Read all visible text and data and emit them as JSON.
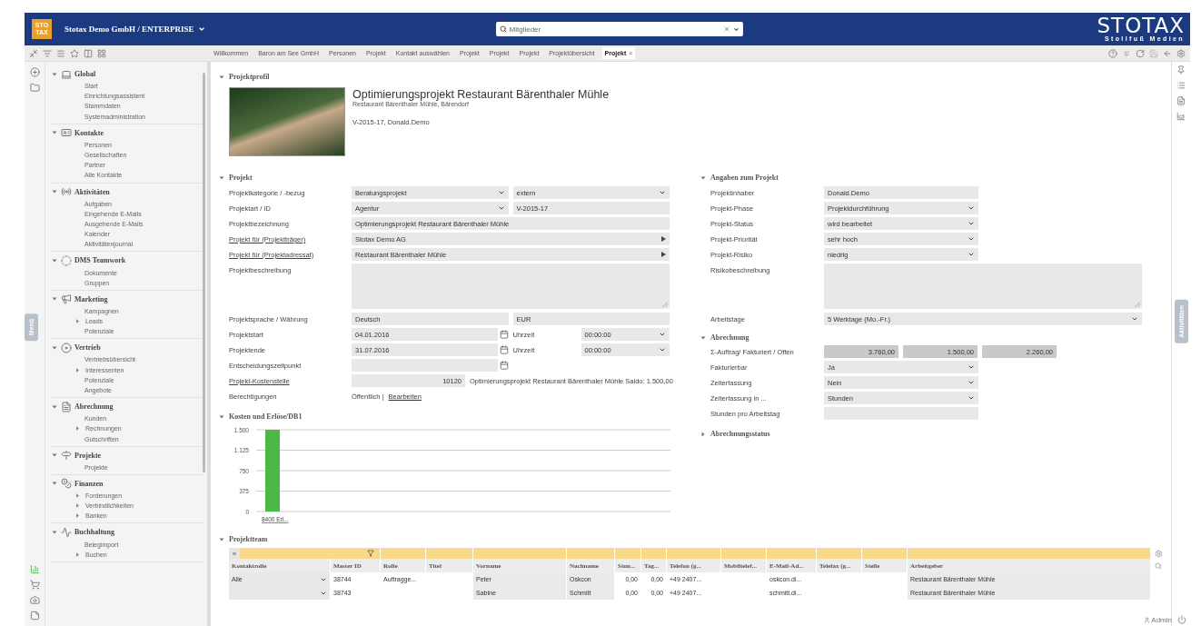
{
  "header": {
    "logo": [
      "STO",
      "TAX"
    ],
    "company": "Stotax Demo GmbH / ENTERPRISE",
    "search": {
      "placeholder": "Mitglieder"
    },
    "brand": "STOTAX",
    "brand_subtitle": "Stollfuß Medien"
  },
  "tabs": [
    {
      "label": "Willkommen",
      "selected": false
    },
    {
      "label": "Baron am See GmbH",
      "selected": false
    },
    {
      "label": "Personen",
      "selected": false
    },
    {
      "label": "Projekt",
      "selected": false
    },
    {
      "label": "Kontakt auswählen",
      "selected": false
    },
    {
      "label": "Projekt",
      "selected": false
    },
    {
      "label": "Projekt",
      "selected": false
    },
    {
      "label": "Projekt",
      "selected": false
    },
    {
      "label": "Projektübersicht",
      "selected": false
    },
    {
      "label": "Projekt",
      "selected": true
    }
  ],
  "tab_close": "×",
  "side_tabs": {
    "left": "Menü",
    "right": "Aktivitäten"
  },
  "sidebar": {
    "groups": [
      {
        "label": "Global",
        "expanded": true,
        "children": [
          {
            "label": "Start",
            "kind": "leaf"
          },
          {
            "label": "Einrichtungsassistent",
            "kind": "leaf"
          },
          {
            "label": "Stammdaten",
            "kind": "leaf"
          },
          {
            "label": "Systemadministration",
            "kind": "leaf"
          }
        ]
      },
      {
        "label": "Kontakte",
        "expanded": true,
        "children": [
          {
            "label": "Personen",
            "kind": "leaf"
          },
          {
            "label": "Gesellschaften",
            "kind": "leaf"
          },
          {
            "label": "Partner",
            "kind": "leaf"
          },
          {
            "label": "Alle Kontakte",
            "kind": "leaf"
          }
        ]
      },
      {
        "label": "Aktivitäten",
        "expanded": true,
        "children": [
          {
            "label": "Aufgaben",
            "kind": "leaf"
          },
          {
            "label": "Eingehende E-Mails",
            "kind": "leaf"
          },
          {
            "label": "Ausgehende E-Mails",
            "kind": "leaf"
          },
          {
            "label": "Kalender",
            "kind": "leaf"
          },
          {
            "label": "Aktivitätenjournal",
            "kind": "leaf"
          }
        ]
      },
      {
        "label": "DMS Teamwork",
        "expanded": true,
        "children": [
          {
            "label": "Dokumente",
            "kind": "leaf"
          },
          {
            "label": "Gruppen",
            "kind": "leaf"
          }
        ]
      },
      {
        "label": "Marketing",
        "expanded": true,
        "children": [
          {
            "label": "Kampagnen",
            "kind": "leaf"
          },
          {
            "label": "Leads",
            "kind": "folder"
          },
          {
            "label": "Potenziale",
            "kind": "leaf"
          }
        ]
      },
      {
        "label": "Vertrieb",
        "expanded": true,
        "children": [
          {
            "label": "Vertriebsübersicht",
            "kind": "leaf"
          },
          {
            "label": "Interessenten",
            "kind": "folder"
          },
          {
            "label": "Potenziale",
            "kind": "leaf"
          },
          {
            "label": "Angebote",
            "kind": "leaf"
          }
        ]
      },
      {
        "label": "Abrechnung",
        "expanded": true,
        "children": [
          {
            "label": "Kunden",
            "kind": "leaf"
          },
          {
            "label": "Rechnungen",
            "kind": "folder"
          },
          {
            "label": "Gutschriften",
            "kind": "leaf"
          }
        ]
      },
      {
        "label": "Projekte",
        "expanded": true,
        "children": [
          {
            "label": "Projekte",
            "kind": "leaf"
          }
        ]
      },
      {
        "label": "Finanzen",
        "expanded": true,
        "children": [
          {
            "label": "Forderungen",
            "kind": "folder"
          },
          {
            "label": "Verbindlichkeiten",
            "kind": "folder"
          },
          {
            "label": "Banken",
            "kind": "folder"
          }
        ]
      },
      {
        "label": "Buchhaltung",
        "expanded": true,
        "children": [
          {
            "label": "Belegimport",
            "kind": "leaf"
          },
          {
            "label": "Buchen",
            "kind": "folder"
          }
        ]
      }
    ]
  },
  "profile": {
    "section": "Projektprofil",
    "expanded": true,
    "title": "Optimierungsprojekt Restaurant Bärenthaler Mühle",
    "subtitle": "Restaurant Bärenthaler Mühle, Bärendorf",
    "meta": "V-2015-17, Donald.Demo"
  },
  "project": {
    "section": "Projekt",
    "expanded": true,
    "rows": [
      {
        "label": "Projektkategorie / -bezug",
        "link": false,
        "kind": "select_pair",
        "values": [
          "Beratungsprojekt",
          "extern"
        ]
      },
      {
        "label": "Projektart / ID",
        "link": false,
        "kind": "select_text",
        "values": [
          "Agentur",
          "V-2015-17"
        ]
      },
      {
        "label": "Projektbezeichnung",
        "link": false,
        "kind": "text",
        "value": "Optimierungsprojekt Restaurant Bärenthaler Mühle"
      },
      {
        "label": "Projekt für (Projektträger)",
        "link": true,
        "kind": "lookup",
        "value": "Stotax Demo AG"
      },
      {
        "label": "Projekt für (Projektadressat)",
        "link": true,
        "kind": "lookup",
        "value": "Restaurant Bärenthaler Mühle"
      },
      {
        "label": "Projektbeschreibung",
        "link": false,
        "kind": "textarea"
      },
      {
        "label": "Projektsprache / Währung",
        "link": false,
        "kind": "text_pair",
        "values": [
          "Deutsch",
          "EUR"
        ]
      },
      {
        "label": "Projektstart",
        "link": false,
        "kind": "date_time",
        "value": "04.01.2016",
        "time_label": "Uhrzeit",
        "time": "00:00:00"
      },
      {
        "label": "Projektende",
        "link": false,
        "kind": "date_time",
        "value": "31.07.2016",
        "time_label": "Uhrzeit",
        "time": "00:00:00"
      },
      {
        "label": "Entscheidungszeitpunkt",
        "link": false,
        "kind": "date"
      },
      {
        "label": "Projekt-Kostenstelle",
        "link": true,
        "kind": "cost_center",
        "value": "10120",
        "note": "Optimierungsprojekt Restaurant Bärenthaler Mühle Saldo: 1.500,00"
      },
      {
        "label": "Berechtigungen",
        "link": false,
        "kind": "permission",
        "value": "Öffentlich |",
        "action": "Bearbeiten"
      }
    ]
  },
  "details": {
    "section": "Angaben zum Projekt",
    "expanded": true,
    "rows": [
      {
        "label": "Projektinhaber",
        "kind": "text",
        "value": "Donald.Demo"
      },
      {
        "label": "Projekt-Phase",
        "kind": "select",
        "value": "Projektdurchführung"
      },
      {
        "label": "Projekt-Status",
        "kind": "select",
        "value": "wird bearbeitet"
      },
      {
        "label": "Projekt-Priorität",
        "kind": "select",
        "value": "sehr hoch"
      },
      {
        "label": "Projekt-Risiko",
        "kind": "select",
        "value": "niedrig"
      },
      {
        "label": "Risikobeschreibung",
        "kind": "textarea"
      },
      {
        "label": "Arbeitstage",
        "kind": "select_wide",
        "value": "5 Werktage (Mo.-Fr.)"
      }
    ]
  },
  "billing": {
    "section": "Abrechnung",
    "expanded": true,
    "rows": [
      {
        "label": "Σ-Auftrag/ Fakturiert / Offen",
        "kind": "amounts",
        "values": [
          "3.760,00",
          "1.500,00",
          "2.260,00"
        ]
      },
      {
        "label": "Fakturierbar",
        "kind": "select",
        "value": "Ja"
      },
      {
        "label": "Zeiterfassung",
        "kind": "select",
        "value": "Nein"
      },
      {
        "label": "Zeiterfassung in ...",
        "kind": "select",
        "value": "Stunden"
      },
      {
        "label": "Stunden pro Arbeitstag",
        "kind": "text"
      }
    ]
  },
  "billing_status": {
    "section": "Abrechnungsstatus",
    "expanded": false
  },
  "costs": {
    "section": "Kosten und Erlöse/DB1",
    "expanded": true,
    "chart_data": {
      "type": "bar",
      "categories": [
        "8400 Erl..."
      ],
      "series": [
        {
          "color": "#4cb848",
          "values": [
            1500
          ]
        }
      ],
      "grid": true,
      "ylim": [
        0,
        1500
      ],
      "yticks": [
        0,
        375,
        750,
        {
          "value": 1125,
          "label": "1.125"
        },
        {
          "value": 1500,
          "label": "1.500"
        }
      ]
    }
  },
  "team": {
    "section": "Projektteam",
    "expanded": true,
    "filter_toggle": "»",
    "columns": [
      "Kontaktrolle",
      "Master ID",
      "Rolle",
      "Titel",
      "Vorname",
      "Nachname",
      "Stun...",
      "Tag...",
      "Telefon (g...",
      "Mobiltelef...",
      "E-Mail-Ad...",
      "Telefax (g...",
      "Stelle",
      "Arbeitgeber"
    ],
    "rows": [
      {
        "cells": [
          "Alle",
          "38744",
          "Auftragge...",
          null,
          "Peter",
          "Oskcon",
          "0,00",
          "0,00",
          "+49 2407...",
          null,
          "oskcon.di...",
          null,
          null,
          "Restaurant Bärenthaler Mühle"
        ]
      },
      {
        "cells": [
          null,
          "38743",
          null,
          null,
          "Sabine",
          "Schmitt",
          "0,00",
          "0,00",
          "+49 2407...",
          null,
          "schmitt.di...",
          null,
          null,
          "Restaurant Bärenthaler Mühle"
        ]
      }
    ]
  },
  "footer": {
    "user": "Admin"
  }
}
